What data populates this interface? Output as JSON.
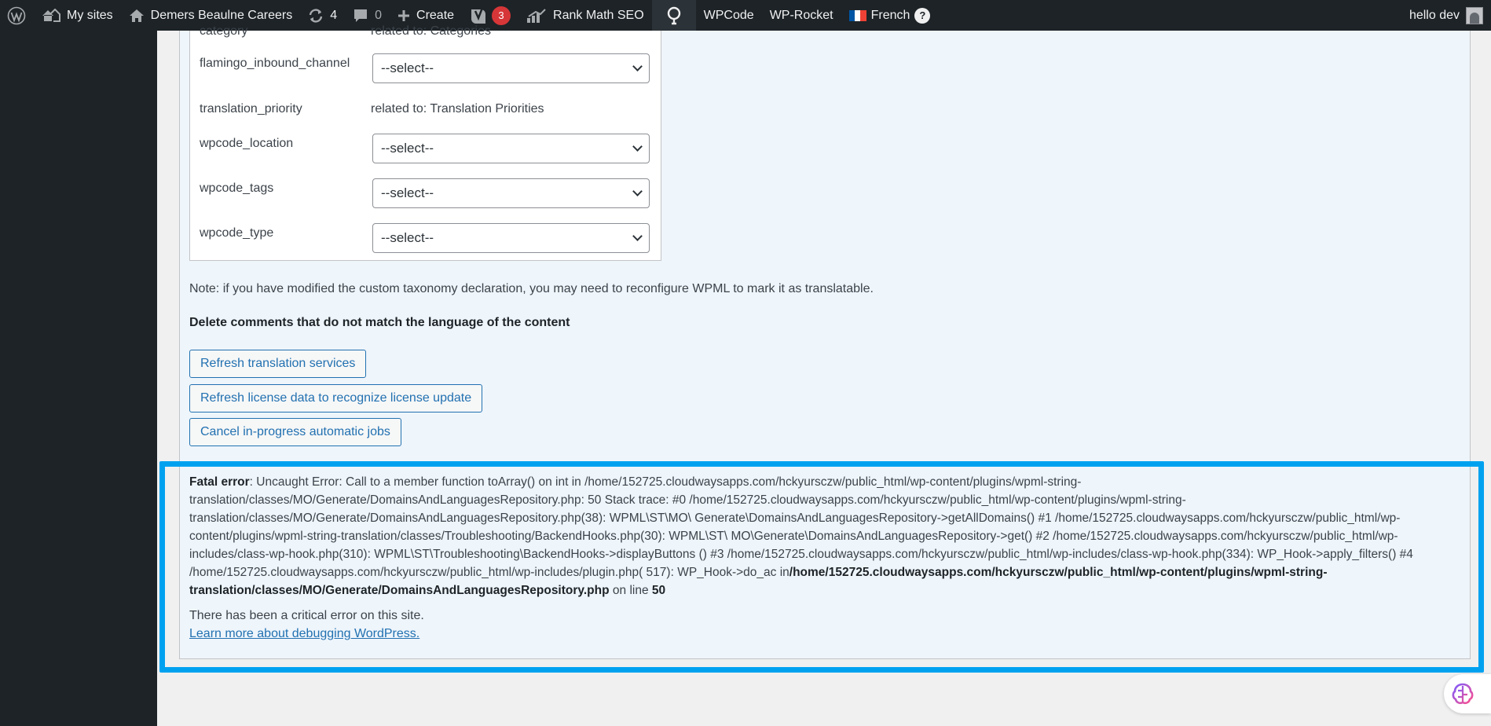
{
  "adminbar": {
    "my_sites": "My sites",
    "site_name": "Demers Beaulne Careers",
    "updates_count": "4",
    "comments_count": "0",
    "create": "Create",
    "yoast_badge": "3",
    "rank_math": "Rank Math SEO",
    "wpcode": "WPCode",
    "wp_rocket": "WP-Rocket",
    "language": "French",
    "help": "?",
    "greeting": "hello dev"
  },
  "taxonomies": {
    "partial_label": "category",
    "partial_value": "related to: Categories",
    "rows": [
      {
        "label": "flamingo_inbound_channel",
        "select": "--select--"
      },
      {
        "label": "translation_priority",
        "value": "related to: Translation Priorities"
      },
      {
        "label": "wpcode_location",
        "select": "--select--"
      },
      {
        "label": "wpcode_tags",
        "select": "--select--"
      },
      {
        "label": "wpcode_type",
        "select": "--select--"
      }
    ]
  },
  "note": "Note: if you have modified the custom taxonomy declaration, you may need to reconfigure WPML to mark it as translatable.",
  "delete_comments_heading": "Delete comments that do not match the language of the content",
  "buttons": {
    "refresh_translation": "Refresh translation services",
    "refresh_license": "Refresh license data to recognize license update",
    "cancel_jobs": "Cancel in-progress automatic jobs"
  },
  "error": {
    "label": "Fatal error",
    "message": ": Uncaught Error: Call to a member function toArray() on int in /home/152725.cloudwaysapps.com/hckyursczw/public_html/wp-content/plugins/wpml-string-translation/classes/MO/Generate/DomainsAndLanguagesRepository.php: 50 Stack trace: #0 /home/152725.cloudwaysapps.com/hckyursczw/public_html/wp-content/plugins/wpml-string-translation/classes/MO/Generate/DomainsAndLanguagesRepository.php(38): WPML\\ST\\MO\\ Generate\\DomainsAndLanguagesRepository->getAllDomains() #1 /home/152725.cloudwaysapps.com/hckyursczw/public_html/wp-content/plugins/wpml-string-translation/classes/Troubleshooting/BackendHooks.php(30): WPML\\ST\\ MO\\Generate\\DomainsAndLanguagesRepository->get() #2 /home/152725.cloudwaysapps.com/hckyursczw/public_html/wp-includes/class-wp-hook.php(310): WPML\\ST\\Troubleshooting\\BackendHooks->displayButtons () #3 /home/152725.cloudwaysapps.com/hckyursczw/public_html/wp-includes/class-wp-hook.php(334): WP_Hook->apply_filters() #4 /home/152725.cloudwaysapps.com/hckyursczw/public_html/wp-includes/plugin.php( 517): WP_Hook->do_ac in",
    "file": "/home/152725.cloudwaysapps.com/hckyursczw/public_html/wp-content/plugins/wpml-string-translation/classes/MO/Generate/DomainsAndLanguagesRepository.php",
    "on_line": " on line ",
    "line": "50",
    "critical": "There has been a critical error on this site.",
    "learn_more": "Learn more about debugging WordPress."
  },
  "colors": {
    "adminbar_bg": "#1d2327",
    "panel_bg": "#eef5fb",
    "error_highlight": "#00a2f0",
    "link": "#2271b1",
    "badge": "#d63638"
  }
}
